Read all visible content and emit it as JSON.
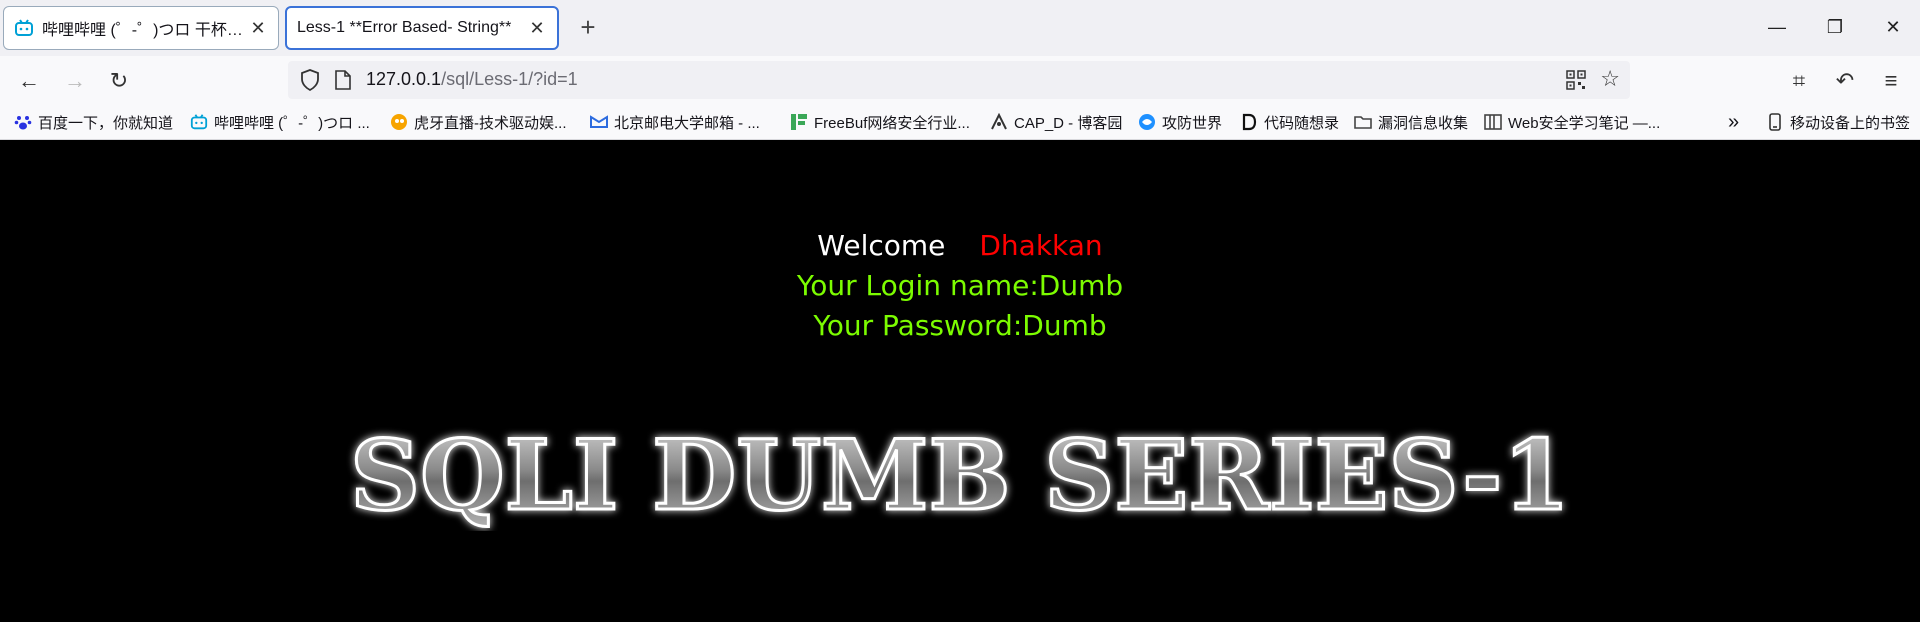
{
  "tabs": [
    {
      "title": "哔哩哔哩 (゜-゜)つロ 干杯~-bilibili",
      "close": "✕",
      "favicon": "bilibili-icon"
    },
    {
      "title": "Less-1 **Error Based- String**",
      "close": "✕",
      "favicon": ""
    }
  ],
  "toolbar": {
    "new_tab": "+",
    "minimize": "—",
    "restore": "❐",
    "close": "✕",
    "back": "←",
    "forward": "→",
    "reload": "↻",
    "star": "☆",
    "crop": "⌗",
    "undo": "↶",
    "menu": "≡"
  },
  "urlbar": {
    "host": "127.0.0.1",
    "path": "/sql/Less-1/?id=1"
  },
  "bookmarks": [
    {
      "label": "百度一下，你就知道",
      "icon": "baidu-paw-icon",
      "color": "#2932e1"
    },
    {
      "label": "哔哩哔哩 (゜-゜)つロ ...",
      "icon": "bilibili-icon",
      "color": "#00a1d6"
    },
    {
      "label": "虎牙直播-技术驱动娱...",
      "icon": "huya-icon",
      "color": "#f7a400"
    },
    {
      "label": "北京邮电大学邮箱 - ...",
      "icon": "mail-icon",
      "color": "#2d6cdf"
    },
    {
      "label": "FreeBuf网络安全行业...",
      "icon": "freebuf-icon",
      "color": "#3aa757"
    },
    {
      "label": "CAP_D - 博客园",
      "icon": "cnblogs-icon",
      "color": "#333333"
    },
    {
      "label": "攻防世界",
      "icon": "adworld-icon",
      "color": "#1e90ff"
    },
    {
      "label": "代码随想录",
      "icon": "d-icon",
      "color": "#111111"
    },
    {
      "label": "漏洞信息收集",
      "icon": "folder-icon",
      "color": "#444444"
    },
    {
      "label": "Web安全学习笔记 —...",
      "icon": "book-icon",
      "color": "#444444"
    }
  ],
  "bookmarks_overflow": "»",
  "mobile_bookmarks": "移动设备上的书签",
  "page": {
    "welcome": "Welcome",
    "name": "Dhakkan",
    "login_line": "Your Login name:Dumb",
    "password_line": "Your Password:Dumb",
    "banner": "SQLI DUMB SERIES-1"
  },
  "colors": {
    "welcome": "#ffffff",
    "name": "#ff0000",
    "credentials": "#7cfc00",
    "background": "#000000",
    "active_tab_border": "#3b72d8"
  }
}
